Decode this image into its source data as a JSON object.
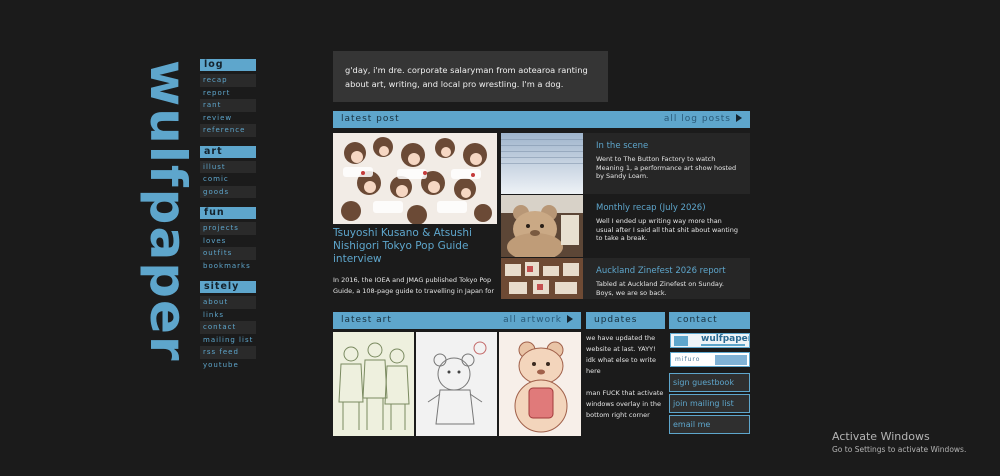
{
  "site": {
    "logo_text": "wulfpaper"
  },
  "nav": [
    {
      "title": "log",
      "items": [
        "recap",
        "report",
        "rant",
        "review",
        "reference"
      ]
    },
    {
      "title": "art",
      "items": [
        "illust",
        "comic",
        "goods"
      ]
    },
    {
      "title": "fun",
      "items": [
        "projects",
        "loves",
        "outfits",
        "bookmarks"
      ]
    },
    {
      "title": "sitely",
      "items": [
        "about",
        "links",
        "contact",
        "mailing list",
        "rss feed",
        "youtube"
      ]
    }
  ],
  "bio": "g'day, i'm dre. corporate salaryman from aotearoa ranting about art, writing, and local pro wrestling. I'm a dog.",
  "latest_post": {
    "label": "latest post",
    "link": "all log posts",
    "main": {
      "title": "Tsuyoshi Kusano & Atsushi Nishigori Tokyo Pop Guide interview",
      "excerpt": "In 2016, the IOEA and JMAG published Tokyo Pop Guide, a 108-page guide to travelling in Japan for"
    },
    "side": [
      {
        "title": "In the scene",
        "body": "Went to The Button Factory to watch Meaning 1, a performance art show hosted by Sandy Loam."
      },
      {
        "title": "Monthly recap (July 2026)",
        "body": "Well I ended up writing way more than usual after I said all that shit about wanting to take a break."
      },
      {
        "title": "Auckland Zinefest 2026 report",
        "body": "Tabled at Auckland Zinefest on Sunday. Boys, we are so back."
      }
    ]
  },
  "latest_art": {
    "label": "latest art",
    "link": "all artwork"
  },
  "updates": {
    "label": "updates",
    "entries": [
      "we have updated the website at last. YAYY! idk what else to write here",
      "man FUCK that activate windows overlay in the bottom right corner"
    ]
  },
  "contact": {
    "label": "contact",
    "badge1": "wulfpaper",
    "badge2": "mifuro",
    "buttons": [
      "sign guestbook",
      "join mailing list",
      "email me"
    ]
  },
  "overlay": {
    "line1": "Activate Windows",
    "line2": "Go to Settings to activate Windows."
  },
  "colors": {
    "accent": "#5ea6cc",
    "bg": "#1b1b1b",
    "panel": "#353535"
  }
}
